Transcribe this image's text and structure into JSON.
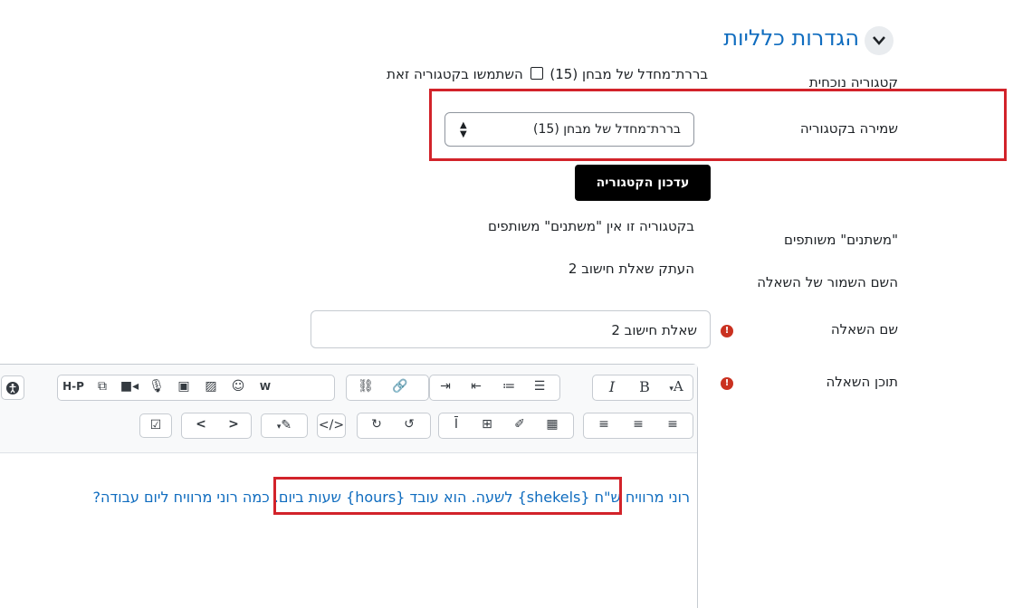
{
  "section": {
    "title": "הגדרות כלליות"
  },
  "current_category": {
    "label": "קטגוריה נוכחית",
    "value": "בררת־מחדל של מבחן (15)",
    "checkbox_label": "השתמשו בקטגוריה זאת"
  },
  "save_in_category": {
    "label": "שמירה בקטגוריה",
    "selected": "בררת־מחדל של מבחן (15)",
    "button": "עדכון הקטגוריה"
  },
  "shared_wildcards": {
    "label": "\"משתנים\" משותפים",
    "value": "בקטגוריה זו אין \"משתנים\" משותפים"
  },
  "saved_name": {
    "label": "השם השמור של השאלה",
    "value": "העתק שאלת חישוב 2"
  },
  "question_name": {
    "label": "שם השאלה",
    "value": "שאלת חישוב 2"
  },
  "question_text": {
    "label": "תוכן השאלה",
    "content": "רוני מרוויח ש\"ח {shekels} לשעה. הוא עובד {hours} שעות ביום. כמה רוני מרוויח ליום עבודה?"
  },
  "toolbar": {
    "row1": [
      "accessibility-icon",
      "h5p-icon",
      "copy-icon",
      "video-icon",
      "microphone-icon",
      "media-icon",
      "image-icon",
      "emoji-icon",
      "word-icon",
      "unlink-icon",
      "link-icon",
      "indent-icon",
      "outdent-icon",
      "numbered-list-icon",
      "bullet-list-icon",
      "italic-icon",
      "bold-icon",
      "text-style-icon"
    ],
    "row2": [
      "checklist-icon",
      "arrow-left-icon",
      "arrow-right-icon",
      "paint-icon",
      "code-icon",
      "redo-icon",
      "undo-icon",
      "cursor-icon",
      "table-icon",
      "edit-icon",
      "calculator-icon",
      "align-right-icon",
      "align-center-icon",
      "align-left-icon"
    ],
    "h5p_text": "H-P",
    "italic_text": "I",
    "bold_text": "B",
    "font_text": "A"
  },
  "colors": {
    "accent": "#0f6cbf",
    "highlight": "#d2232a",
    "error": "#ca3120"
  }
}
